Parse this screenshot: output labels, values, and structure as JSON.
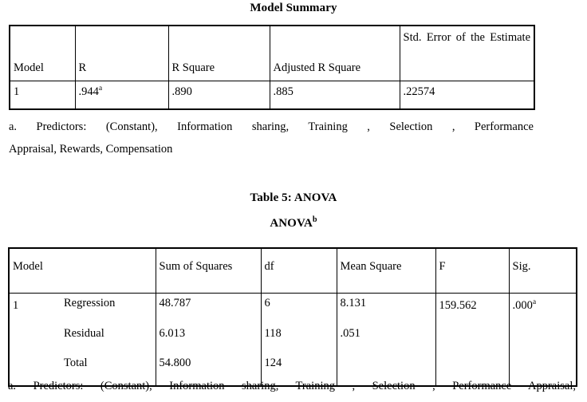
{
  "document": {
    "model_summary_title": "Model Summary",
    "anova_table_caption": "Table 5: ANOVA",
    "anova_subtitle_text": "ANOVA",
    "anova_subtitle_superscript": "b"
  },
  "model_summary": {
    "headers": {
      "model": "Model",
      "r": "R",
      "r_square": "R Square",
      "adjusted_r_square": "Adjusted R Square",
      "std_error_line1": "Std. Error of the",
      "std_error_line2": "Estimate"
    },
    "row": {
      "model": "1",
      "r_value": ".944",
      "r_superscript": "a",
      "r_square": ".890",
      "adjusted_r_square": ".885",
      "std_error_estimate": ".22574"
    },
    "footnote": {
      "line1": "a. Predictors: (Constant), Information sharing, Training , Selection , Performance",
      "line2": "Appraisal, Rewards, Compensation"
    }
  },
  "anova": {
    "headers": {
      "model": "Model",
      "sum_of_squares": "Sum of Squares",
      "df": "df",
      "mean_square": "Mean Square",
      "f": "F",
      "sig": "Sig."
    },
    "model_number": "1",
    "terms": {
      "regression": "Regression",
      "residual": "Residual",
      "total": "Total"
    },
    "sum_of_squares": {
      "regression": "48.787",
      "residual": "6.013",
      "total": "54.800"
    },
    "df": {
      "regression": "6",
      "residual": "118",
      "total": "124"
    },
    "mean_square": {
      "regression": "8.131",
      "residual": ".051",
      "total": ""
    },
    "f": {
      "regression": "159.562"
    },
    "sig": {
      "regression": ".000",
      "superscript": "a"
    },
    "footnote": {
      "line1": "a. Predictors: (Constant), Information sharing, Training , Selection , Performance Appraisal,"
    }
  }
}
